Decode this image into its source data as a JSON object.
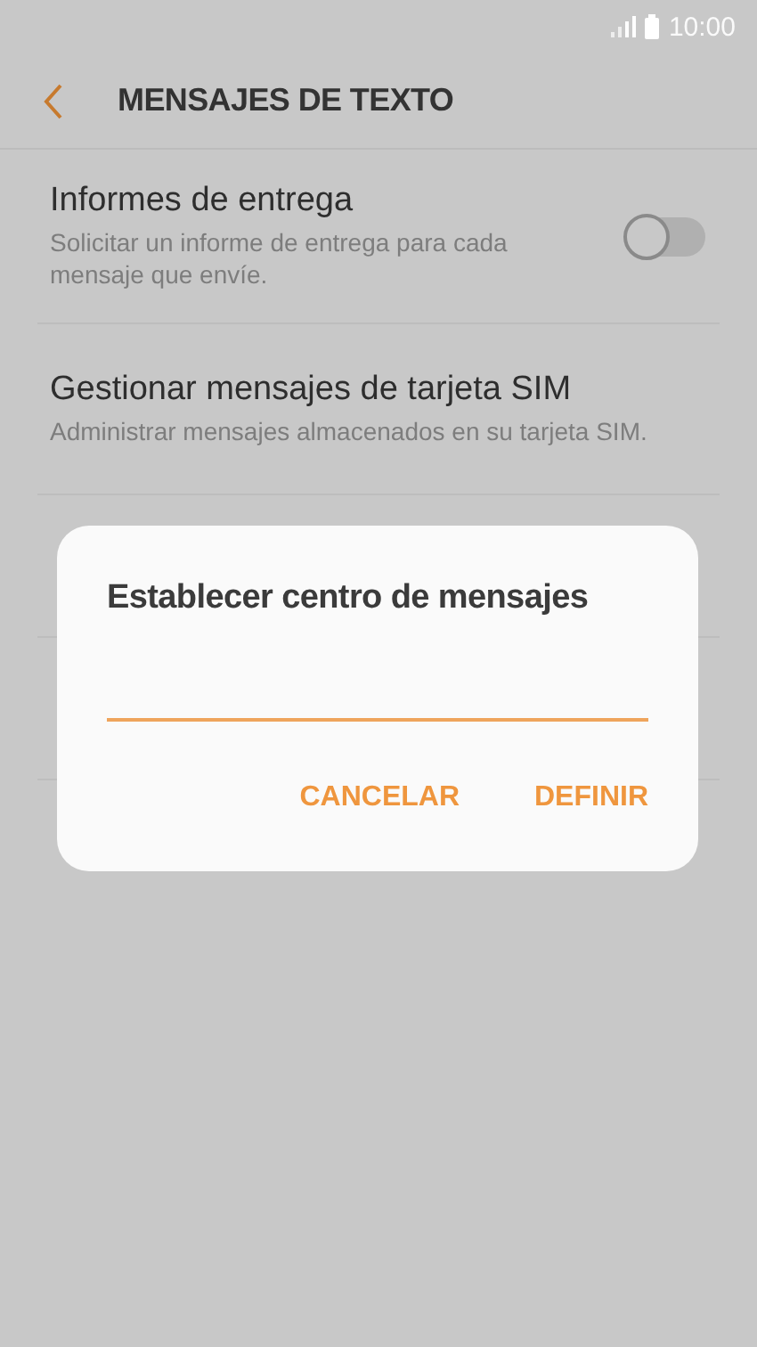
{
  "status_bar": {
    "time": "10:00"
  },
  "header": {
    "title": "MENSAJES DE TEXTO"
  },
  "settings": [
    {
      "kind": "toggle",
      "title": "Informes de entrega",
      "subtitle": "Solicitar un informe de entrega para cada mensaje que envíe.",
      "on": false
    },
    {
      "kind": "plain",
      "title": "Gestionar mensajes de tarjeta SIM",
      "subtitle": "Administrar mensajes almacenados en su tarjeta SIM."
    }
  ],
  "dialog": {
    "title": "Establecer centro de mensajes",
    "buttons": [
      "CANCELAR",
      "DEFINIR"
    ]
  }
}
